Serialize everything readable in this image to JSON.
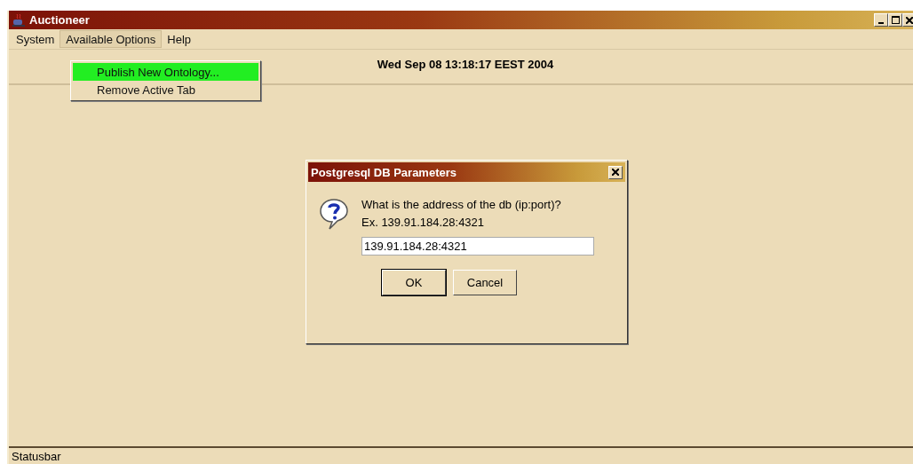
{
  "window": {
    "title": "Auctioneer"
  },
  "menu_bar": [
    {
      "label": "System",
      "selected": false
    },
    {
      "label": "Available Options",
      "selected": true
    },
    {
      "label": "Help",
      "selected": false
    }
  ],
  "dropdown": [
    {
      "label": "Publish New Ontology...",
      "selected": true
    },
    {
      "label": "Remove Active Tab",
      "selected": false
    }
  ],
  "date_label": "Wed Sep 08 13:18:17 EEST 2004",
  "dialog": {
    "title": "Postgresql DB Parameters",
    "question": "What is the address of the db (ip:port)?",
    "example": "Ex. 139.91.184.28:4321",
    "value": "139.91.184.28:4321",
    "buttons": [
      {
        "label": "OK",
        "selected": true
      },
      {
        "label": "Cancel",
        "selected": false
      }
    ]
  },
  "status_bar": "Statusbar"
}
